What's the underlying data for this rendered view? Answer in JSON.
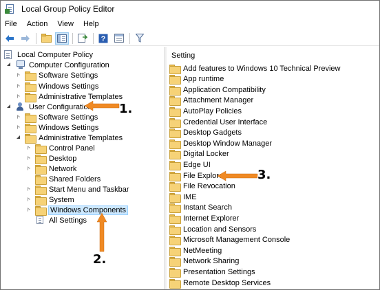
{
  "window": {
    "title": "Local Group Policy Editor"
  },
  "menu": [
    "File",
    "Action",
    "View",
    "Help"
  ],
  "toolbar_icons": [
    "back-arrow-icon",
    "forward-arrow-icon",
    "up-folder-icon",
    "show-hide-tree-icon",
    "export-list-icon",
    "help-icon",
    "properties-icon",
    "filter-icon"
  ],
  "tree": {
    "root": "Local Computer Policy",
    "computer_configuration": {
      "label": "Computer Configuration",
      "children": [
        "Software Settings",
        "Windows Settings",
        "Administrative Templates"
      ]
    },
    "user_configuration": {
      "label": "User Configuration",
      "children": [
        "Software Settings",
        "Windows Settings",
        "Administrative Templates"
      ],
      "admin_templates_children": [
        "Control Panel",
        "Desktop",
        "Network",
        "Shared Folders",
        "Start Menu and Taskbar",
        "System",
        "Windows Components",
        "All Settings"
      ]
    }
  },
  "right_pane": {
    "header": "Setting",
    "items": [
      "Add features to Windows 10 Technical Preview",
      "App runtime",
      "Application Compatibility",
      "Attachment Manager",
      "AutoPlay Policies",
      "Credential User Interface",
      "Desktop Gadgets",
      "Desktop Window Manager",
      "Digital Locker",
      "Edge UI",
      "File Explorer",
      "File Revocation",
      "IME",
      "Instant Search",
      "Internet Explorer",
      "Location and Sensors",
      "Microsoft Management Console",
      "NetMeeting",
      "Network Sharing",
      "Presentation Settings",
      "Remote Desktop Services"
    ]
  },
  "annotations": [
    "1.",
    "2.",
    "3."
  ],
  "colors": {
    "annotation_arrow": "#f08a24",
    "selection": "#cce8ff",
    "folder": "#f6d277"
  }
}
